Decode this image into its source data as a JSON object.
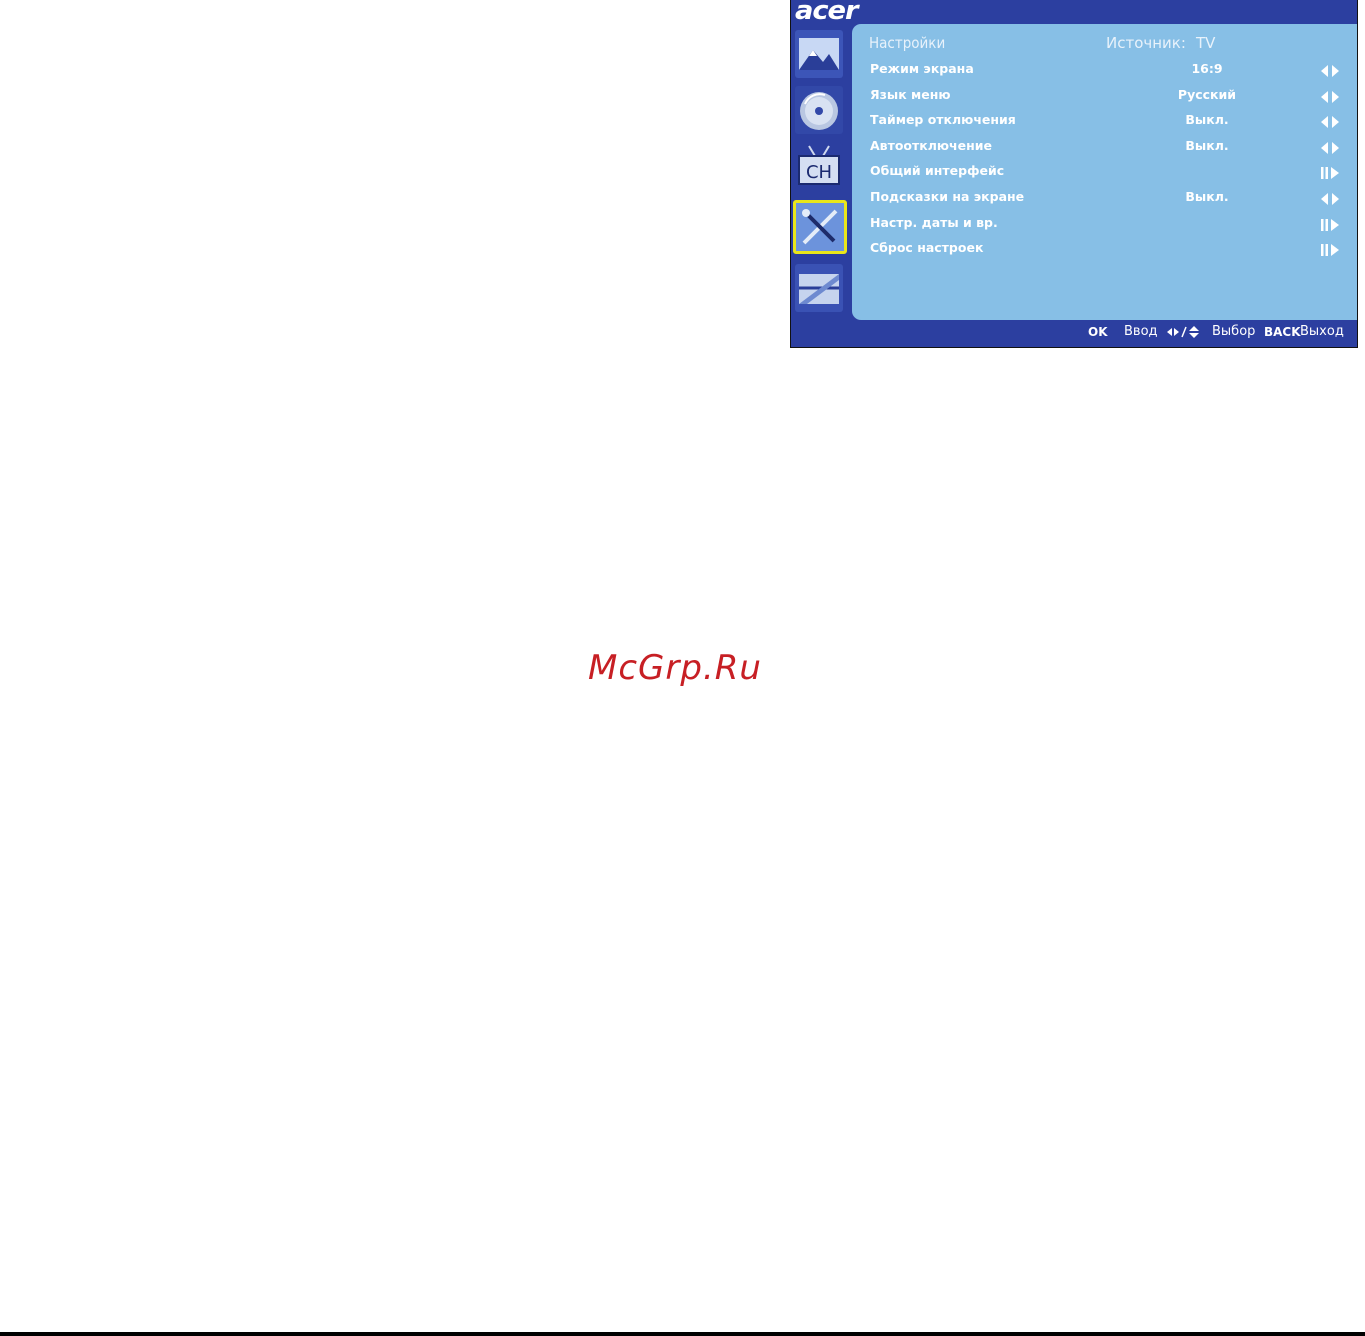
{
  "brand": {
    "logo_text": "acer"
  },
  "sidebar": {
    "items": [
      {
        "icon": "picture-icon",
        "selected": false
      },
      {
        "icon": "audio-disc-icon",
        "selected": false
      },
      {
        "icon": "channel-tv-icon",
        "label": "CH",
        "selected": false
      },
      {
        "icon": "settings-tools-icon",
        "selected": true
      },
      {
        "icon": "media-icon",
        "selected": false
      }
    ]
  },
  "menu": {
    "title": "Настройки",
    "source_label": "Источник:",
    "source_value": "TV",
    "rows": [
      {
        "label": "Режим экрана",
        "value": "16:9",
        "control": "left-right-arrows-icon"
      },
      {
        "label": "Язык меню",
        "value": "Русский",
        "control": "left-right-arrows-icon"
      },
      {
        "label": "Таймер отключения",
        "value": "Выкл.",
        "control": "left-right-arrows-icon"
      },
      {
        "label": "Автоотключение",
        "value": "Выкл.",
        "control": "left-right-arrows-icon"
      },
      {
        "label": "Общий интерфейс",
        "value": "",
        "control": "enter-submenu-icon"
      },
      {
        "label": "Подсказки на экране",
        "value": "Выкл.",
        "control": "left-right-arrows-icon"
      },
      {
        "label": "Настр. даты и вр.",
        "value": "",
        "control": "enter-submenu-icon"
      },
      {
        "label": "Сброс настроек",
        "value": "",
        "control": "enter-submenu-icon"
      }
    ]
  },
  "footer": {
    "ok_key": "OK",
    "ok_action": "Ввод",
    "nav_action": "Выбор",
    "back_key": "BACK",
    "back_action": "Выход"
  },
  "watermark": {
    "text": "McGrp.Ru"
  },
  "colors": {
    "frame_blue": "#2c3fa0",
    "panel_blue": "#87bfe6",
    "selection_yellow": "#e9e61a",
    "watermark_red": "#c71f24"
  }
}
